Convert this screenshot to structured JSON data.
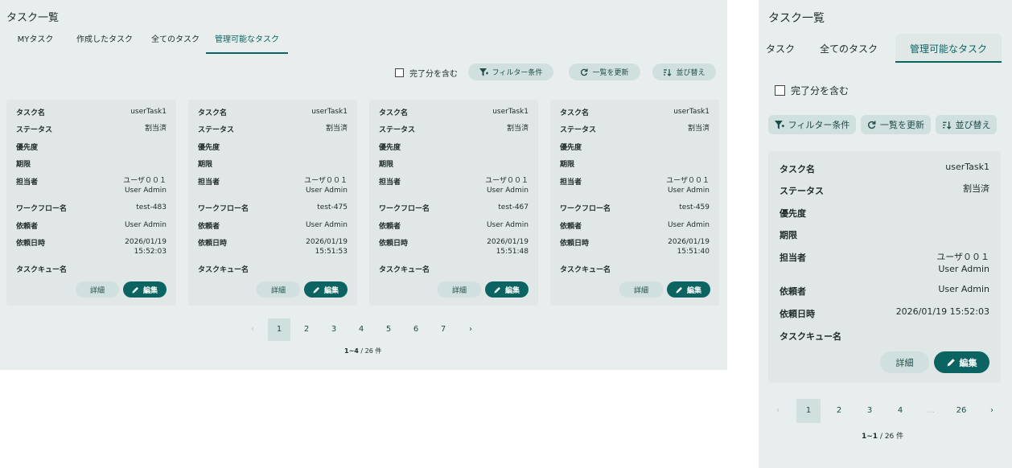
{
  "wide": {
    "title": "タスク一覧",
    "tabs": [
      "MYタスク",
      "作成したタスク",
      "全てのタスク",
      "管理可能なタスク"
    ],
    "include_completed": "完了分を含む",
    "filter_label": "フィルター条件",
    "refresh_label": "一覧を更新",
    "sort_label": "並び替え",
    "labels": {
      "task_name": "タスク名",
      "status": "ステータス",
      "priority": "優先度",
      "deadline": "期限",
      "assignee": "担当者",
      "workflow": "ワークフロー名",
      "requester": "依頼者",
      "request_date": "依頼日時",
      "task_queue": "タスクキュー名"
    },
    "cards": [
      {
        "task_name": "userTask1",
        "status": "割当済",
        "assignee1": "ユーザ００１",
        "assignee2": "User Admin",
        "workflow": "test-483",
        "requester": "User Admin",
        "date": "2026/01/19",
        "time": "15:52:03"
      },
      {
        "task_name": "userTask1",
        "status": "割当済",
        "assignee1": "ユーザ００１",
        "assignee2": "User Admin",
        "workflow": "test-475",
        "requester": "User Admin",
        "date": "2026/01/19",
        "time": "15:51:53"
      },
      {
        "task_name": "userTask1",
        "status": "割当済",
        "assignee1": "ユーザ００１",
        "assignee2": "User Admin",
        "workflow": "test-467",
        "requester": "User Admin",
        "date": "2026/01/19",
        "time": "15:51:48"
      },
      {
        "task_name": "userTask1",
        "status": "割当済",
        "assignee1": "ユーザ００１",
        "assignee2": "User Admin",
        "workflow": "test-459",
        "requester": "User Admin",
        "date": "2026/01/19",
        "time": "15:51:40"
      }
    ],
    "detail_label": "詳細",
    "edit_label": "編集",
    "pages": [
      "1",
      "2",
      "3",
      "4",
      "5",
      "6",
      "7"
    ],
    "count_range": "1~4",
    "count_total": " / 26 件"
  },
  "narrow": {
    "title": "タスク一覧",
    "tabs": [
      "タスク",
      "全てのタスク",
      "管理可能なタスク"
    ],
    "include_completed": "完了分を含む",
    "filter_label": "フィルター条件",
    "refresh_label": "一覧を更新",
    "sort_label": "並び替え",
    "card": {
      "task_name": "userTask1",
      "status": "割当済",
      "assignee1": "ユーザ００１",
      "assignee2": "User Admin",
      "requester": "User Admin",
      "datetime": "2026/01/19 15:52:03"
    },
    "detail_label": "詳細",
    "edit_label": "編集",
    "pages": [
      "1",
      "2",
      "3",
      "4",
      "…",
      "26"
    ],
    "count_range": "1~1",
    "count_total": " / 26 件"
  },
  "colors": {
    "accent": "#0b6461",
    "panel": "#e8eeed",
    "card": "#e0e7e6",
    "button": "#cfe0de"
  }
}
